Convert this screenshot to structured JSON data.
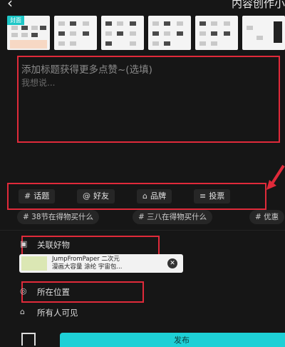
{
  "header": {
    "back_icon": "chevron-left-icon",
    "title": "内容创作小"
  },
  "thumbnails": {
    "cover_label": "封面",
    "count": 6
  },
  "editor": {
    "title_placeholder": "添加标题获得更多点赞~(选填)",
    "body_placeholder": "我想说..."
  },
  "tools": [
    {
      "icon": "#",
      "label": "话题"
    },
    {
      "icon": "@",
      "label": "好友"
    },
    {
      "icon": "⌂",
      "label": "品牌"
    },
    {
      "icon": "≡",
      "label": "投票"
    }
  ],
  "topics": [
    {
      "icon": "#",
      "label": "38节在得物买什么"
    },
    {
      "icon": "#",
      "label": "三八在得物买什么"
    },
    {
      "icon": "#",
      "label": "优惠"
    }
  ],
  "linked_goods": {
    "label": "关联好物",
    "product_line1": "JumpFromPaper 二次元",
    "product_line2": "漫画大容量 涂纶 宇宙包..."
  },
  "location": {
    "label": "所在位置"
  },
  "visibility": {
    "label": "所有人可见"
  },
  "footer": {
    "publish_label": "发布"
  },
  "annotation_color": "#e02a3a",
  "accent_color": "#1ed0d6"
}
